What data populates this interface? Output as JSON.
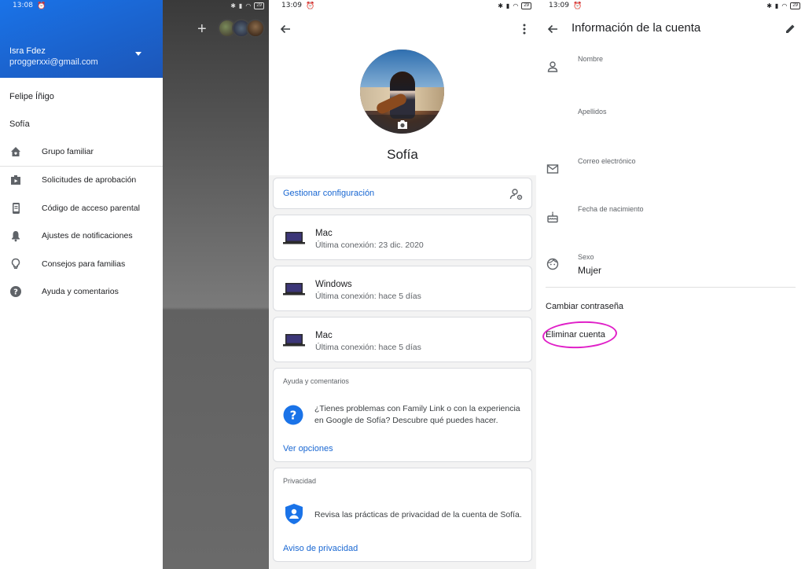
{
  "colors": {
    "accent_blue": "#1a73e8",
    "link_blue": "#1967d2",
    "highlight_magenta": "#e020c8",
    "shield_blue": "#1a73e8",
    "help_blue": "#1a73e8"
  },
  "drawer_screen": {
    "status_time": "13:08",
    "battery": "29",
    "account": {
      "name": "Isra Fdez",
      "email": "proggerxxi@gmail.com"
    },
    "children": [
      "Felipe Íñigo",
      "Sofía"
    ],
    "menu": [
      {
        "label": "Grupo familiar",
        "icon": "home-heart-icon"
      },
      {
        "label": "Solicitudes de aprobación",
        "icon": "play-store-icon"
      },
      {
        "label": "Código de acceso parental",
        "icon": "phone-code-icon"
      },
      {
        "label": "Ajustes de notificaciones",
        "icon": "bell-icon"
      },
      {
        "label": "Consejos para familias",
        "icon": "lightbulb-icon"
      },
      {
        "label": "Ayuda y comentarios",
        "icon": "help-icon"
      }
    ]
  },
  "profile_screen": {
    "status_time": "13:09",
    "battery": "29",
    "name": "Sofía",
    "manage_settings": "Gestionar configuración",
    "devices": [
      {
        "name": "Mac",
        "last_seen": "Última conexión: 23 dic. 2020"
      },
      {
        "name": "Windows",
        "last_seen": "Última conexión: hace 5 días"
      },
      {
        "name": "Mac",
        "last_seen": "Última conexión: hace 5 días"
      }
    ],
    "help_card": {
      "title": "Ayuda y comentarios",
      "text": "¿Tienes problemas con Family Link o con la experiencia en Google de Sofía? Descubre qué puedes hacer.",
      "link": "Ver opciones"
    },
    "privacy_card": {
      "title": "Privacidad",
      "text": "Revisa las prácticas de privacidad de la cuenta de Sofía.",
      "link": "Aviso de privacidad"
    }
  },
  "account_screen": {
    "status_time": "13:09",
    "battery": "29",
    "title": "Información de la cuenta",
    "fields": [
      {
        "label": "Nombre",
        "value": "",
        "icon": "person-icon"
      },
      {
        "label": "Apellidos",
        "value": "",
        "icon": ""
      },
      {
        "label": "Correo electrónico",
        "value": "",
        "icon": "email-icon"
      },
      {
        "label": "Fecha de nacimiento",
        "value": "",
        "icon": "cake-icon"
      },
      {
        "label": "Sexo",
        "value": "Mujer",
        "icon": "face-icon"
      }
    ],
    "change_password": "Cambiar contraseña",
    "delete_account": "Eliminar cuenta"
  }
}
